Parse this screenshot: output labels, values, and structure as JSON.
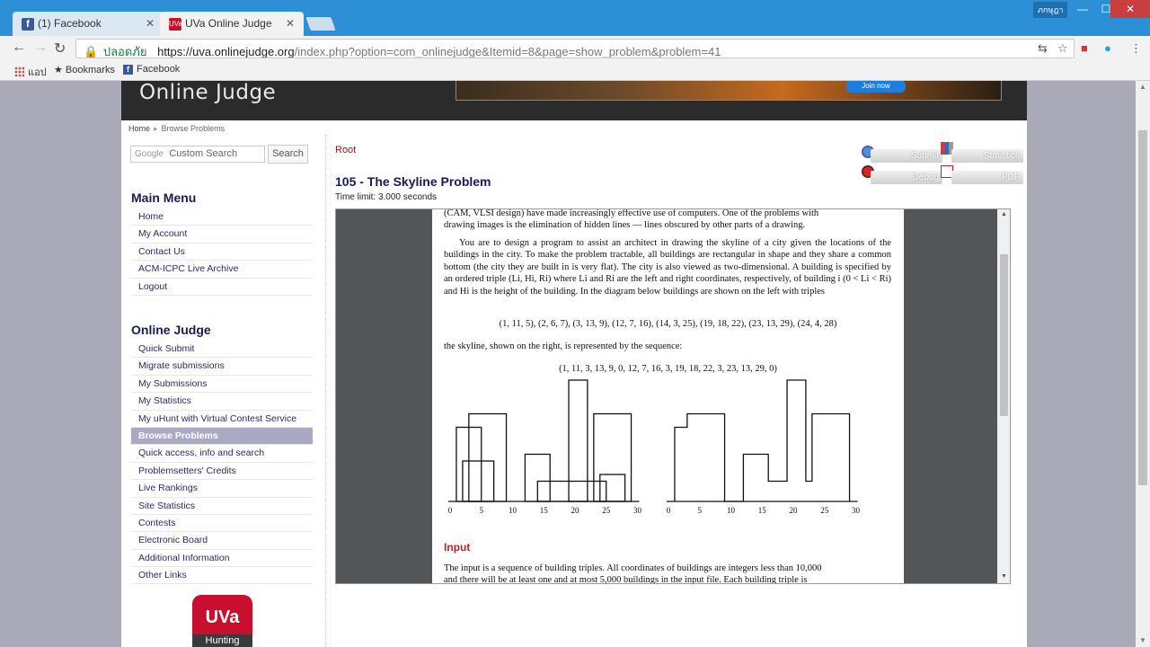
{
  "browser": {
    "tabs": [
      {
        "title": "(1) Facebook",
        "icon": "facebook-icon"
      },
      {
        "title": "UVa Online Judge",
        "icon": "uva-icon"
      }
    ],
    "user_badge": "ภกษุฎา",
    "secure_label": "ปลอดภัย",
    "url_host": "https://uva.onlinejudge.org",
    "url_rest": "/index.php?option=com_onlinejudge&Itemid=8&page=show_problem&problem=41",
    "bookmarks": {
      "apps": "แอป",
      "bookmarks": "Bookmarks",
      "facebook": "Facebook"
    }
  },
  "site": {
    "banner_title": "Online Judge",
    "ad_button": "Join now",
    "breadcrumb": {
      "home": "Home",
      "current": "Browse Problems"
    },
    "search": {
      "placeholder": "Custom Search",
      "google": "Google",
      "button": "Search"
    }
  },
  "main_menu": {
    "heading": "Main Menu",
    "items": [
      "Home",
      "My Account",
      "Contact Us",
      "ACM-ICPC Live Archive",
      "Logout"
    ]
  },
  "oj_menu": {
    "heading": "Online Judge",
    "items": [
      "Quick Submit",
      "Migrate submissions",
      "My Submissions",
      "My Statistics",
      "My uHunt with Virtual Contest Service",
      "Browse Problems",
      "Quick access, info and search",
      "Problemsetters' Credits",
      "Live Rankings",
      "Site Statistics",
      "Contests",
      "Electronic Board",
      "Additional Information",
      "Other Links"
    ],
    "active_index": 5
  },
  "logo": {
    "text": "UVa",
    "sub": "Hunting"
  },
  "problem": {
    "root": "Root",
    "title": "105 - The Skyline Problem",
    "time_limit": "Time limit: 3.000 seconds",
    "actions": {
      "submit": "Submit",
      "statistics": "Statistics",
      "debug": "Debug",
      "pdf": "PDF"
    }
  },
  "pdf": {
    "line0": "(CAM, VLSI design) have made increasingly effective use of computers.  One of the problems with",
    "line1": "drawing images is the elimination of hidden lines — lines obscured by other parts of a drawing.",
    "para": "You are to design a program to assist an architect in drawing the skyline of a city given the locations of the buildings in the city. To make the problem tractable, all buildings are rectangular in shape and they share a common bottom (the city they are built in is very flat). The city is also viewed as two-dimensional. A building is specified by an ordered triple (Li, Hi, Ri) where Li and Ri are the left and right coordinates, respectively, of building i (0 < Li < Ri) and Hi is the height of the building. In the diagram below buildings are shown on the left with triples",
    "triples": "(1, 11, 5), (2, 6, 7), (3, 13, 9), (12, 7, 16), (14, 3, 25), (19, 18, 22), (23, 13, 29), (24, 4, 28)",
    "skyline_intro": "the skyline, shown on the right, is represented by the sequence:",
    "sequence": "(1, 11, 3, 13, 9, 0, 12, 7, 16, 3, 19, 18, 22, 3, 23, 13, 29, 0)",
    "input_heading": "Input",
    "input_text": "The input is a sequence of building triples.  All coordinates of buildings are integers less than 10,000",
    "input_text2": "and there will be at least one and at most 5,000 buildings in the input file.  Each building triple is",
    "ticks": [
      "0",
      "5",
      "10",
      "15",
      "20",
      "25",
      "30"
    ],
    "buildings": [
      [
        1,
        11,
        5
      ],
      [
        2,
        6,
        7
      ],
      [
        3,
        13,
        9
      ],
      [
        12,
        7,
        16
      ],
      [
        14,
        3,
        25
      ],
      [
        19,
        18,
        22
      ],
      [
        23,
        13,
        29
      ],
      [
        24,
        4,
        28
      ]
    ],
    "skyline": [
      1,
      11,
      3,
      13,
      9,
      0,
      12,
      7,
      16,
      3,
      19,
      18,
      22,
      3,
      23,
      13,
      29,
      0
    ]
  }
}
